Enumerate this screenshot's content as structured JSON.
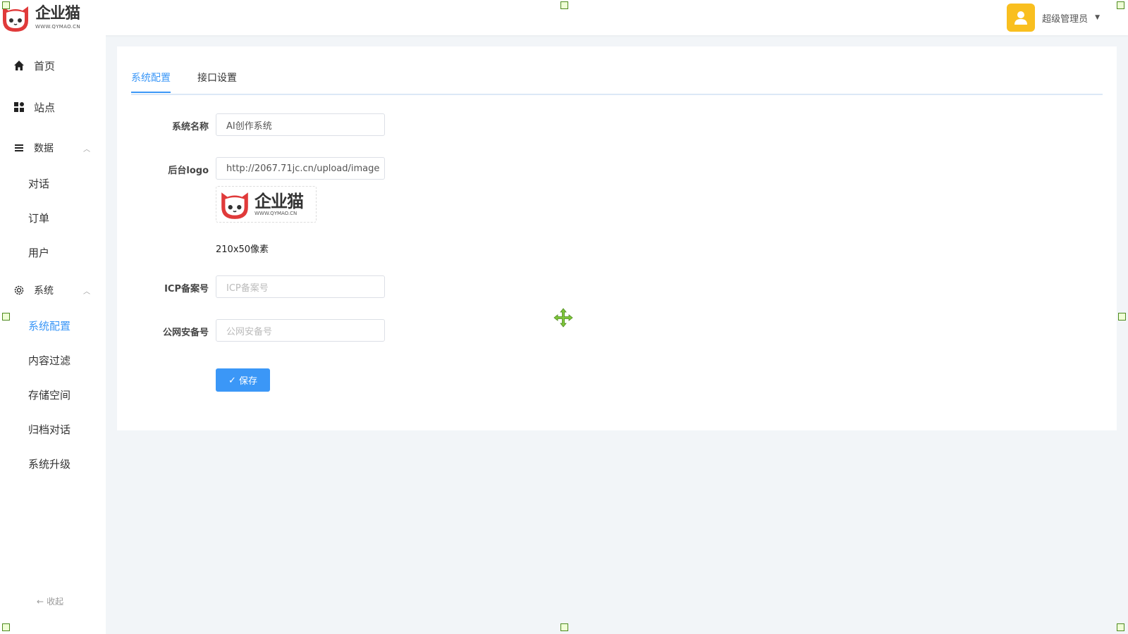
{
  "header": {
    "logo_text": "企业猫",
    "logo_subtext": "WWW.QYMAO.CN",
    "user_name": "超级管理员"
  },
  "sidebar": {
    "items": [
      {
        "label": "首页",
        "icon": "home-icon"
      },
      {
        "label": "站点",
        "icon": "grid-icon"
      },
      {
        "label": "数据",
        "icon": "list-icon",
        "expanded": true
      },
      {
        "label": "系统",
        "icon": "gear-icon",
        "expanded": true
      }
    ],
    "data_children": [
      "对话",
      "订单",
      "用户"
    ],
    "system_children": [
      "系统配置",
      "内容过滤",
      "存储空间",
      "归档对话",
      "系统升级"
    ],
    "active_child": "系统配置",
    "collapse_label": "收起"
  },
  "tabs": [
    {
      "label": "系统配置",
      "active": true
    },
    {
      "label": "接口设置",
      "active": false
    }
  ],
  "form": {
    "system_name": {
      "label": "系统名称",
      "value": "AI创作系统"
    },
    "backend_logo": {
      "label": "后台logo",
      "value": "http://2067.71jc.cn/upload/image"
    },
    "logo_hint": "210x50像素",
    "icp": {
      "label": "ICP备案号",
      "placeholder": "ICP备案号"
    },
    "police": {
      "label": "公网安备号",
      "placeholder": "公网安备号"
    },
    "save_label": "保存"
  },
  "colors": {
    "accent": "#3b97f7",
    "avatar": "#f9bf1f",
    "background": "#f2f5f8",
    "logo_red": "#e03a3a"
  }
}
